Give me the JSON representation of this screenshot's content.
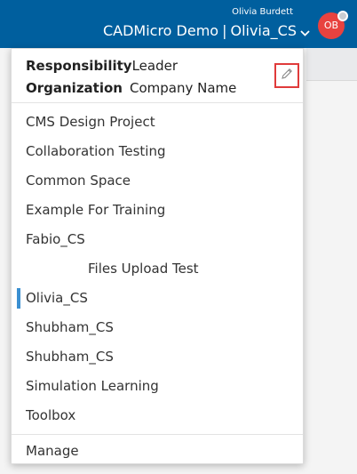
{
  "header": {
    "user_name": "Olivia Burdett",
    "tenant": "CADMicro Demo",
    "separator": "|",
    "workspace": "Olivia_CS",
    "avatar_initials": "OB",
    "bar_color": "#005f9e",
    "avatar_color": "#e8423f"
  },
  "dropdown": {
    "responsibility_label": "Responsibility",
    "responsibility_value": "Leader",
    "organization_label": "Organization",
    "organization_value": "Company Name",
    "items": [
      {
        "label": "CMS Design Project"
      },
      {
        "label": "Collaboration Testing"
      },
      {
        "label": "Common Space"
      },
      {
        "label": "Example For Training"
      },
      {
        "label": "Fabio_CS"
      },
      {
        "label": "Files Upload Test"
      },
      {
        "label": "Olivia_CS",
        "selected": true
      },
      {
        "label": "Shubham_CS"
      },
      {
        "label": "Shubham_CS"
      },
      {
        "label": "Simulation Learning"
      },
      {
        "label": "Toolbox"
      }
    ],
    "manage_label": "Manage",
    "highlight_color": "#e03b3b",
    "selected_color": "#3a8fd1"
  }
}
